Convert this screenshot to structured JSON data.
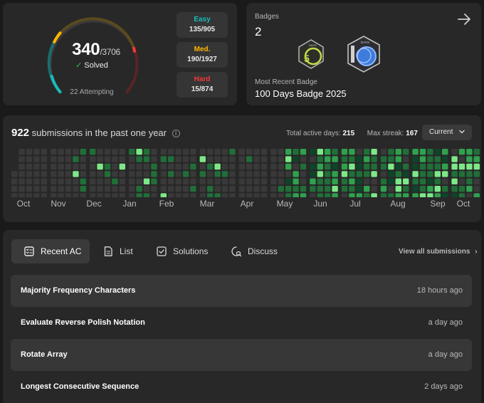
{
  "progress": {
    "solved": "340",
    "total": "/3706",
    "solved_label": "Solved",
    "attempting": "22 Attempting",
    "difficulties": [
      {
        "name": "Easy",
        "count": "135/905",
        "color": "#1cbaba"
      },
      {
        "name": "Med.",
        "count": "190/1927",
        "color": "#ffb700"
      },
      {
        "name": "Hard",
        "count": "15/874",
        "color": "#f63737"
      }
    ]
  },
  "badges": {
    "label": "Badges",
    "count": "2",
    "recent_label": "Most Recent Badge",
    "recent_name": "100 Days Badge 2025"
  },
  "submissions": {
    "count": "922",
    "title_text": "submissions in the past one year",
    "active_days_label": "Total active days:",
    "active_days": "215",
    "max_streak_label": "Max streak:",
    "max_streak": "167",
    "year_select": "Current",
    "months": [
      "Oct",
      "Nov",
      "Dec",
      "Jan",
      "Feb",
      "Mar",
      "Apr",
      "May",
      "Jun",
      "Jul",
      "Aug",
      "Sep",
      "Oct"
    ],
    "heat_colors": [
      "#393939",
      "#0e4429",
      "#216e39",
      "#30a14e",
      "#7ee787"
    ]
  },
  "tabs": [
    {
      "label": "Recent AC",
      "icon": "recent-ac-icon"
    },
    {
      "label": "List",
      "icon": "list-icon"
    },
    {
      "label": "Solutions",
      "icon": "solutions-icon"
    },
    {
      "label": "Discuss",
      "icon": "discuss-icon"
    }
  ],
  "view_all": "View all submissions",
  "recent_ac": [
    {
      "title": "Majority Frequency Characters",
      "time": "18 hours ago"
    },
    {
      "title": "Evaluate Reverse Polish Notation",
      "time": "a day ago"
    },
    {
      "title": "Rotate Array",
      "time": "a day ago"
    },
    {
      "title": "Longest Consecutive Sequence",
      "time": "2 days ago"
    }
  ]
}
